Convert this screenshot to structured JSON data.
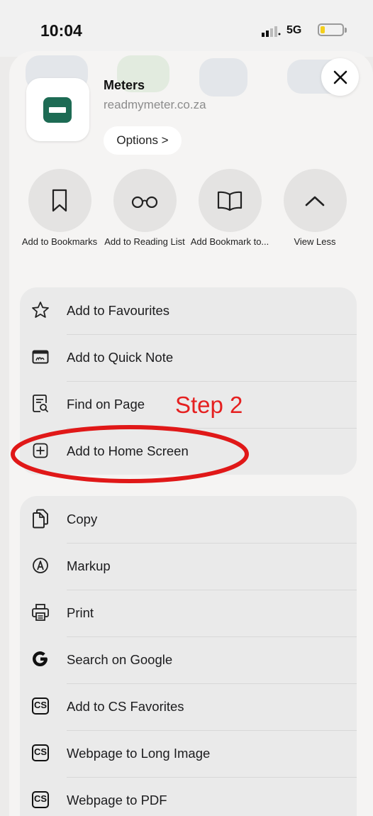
{
  "status_bar": {
    "time": "10:04",
    "network": "5G",
    "battery_level": 0.2
  },
  "header": {
    "app_title": "Meters",
    "app_url": "readmymeter.co.za",
    "options_label": "Options >",
    "close_icon": "close-icon",
    "app_icon": "meter-app-icon"
  },
  "actions": [
    {
      "label": "Add to Bookmarks",
      "icon": "bookmark-icon"
    },
    {
      "label": "Add to Reading List",
      "icon": "glasses-icon"
    },
    {
      "label": "Add Bookmark to...",
      "icon": "book-icon"
    },
    {
      "label": "View Less",
      "icon": "chevron-up-icon"
    }
  ],
  "menu_group_1": [
    {
      "label": "Add to Favourites",
      "icon": "star-icon"
    },
    {
      "label": "Add to Quick Note",
      "icon": "quick-note-icon"
    },
    {
      "label": "Find on Page",
      "icon": "find-on-page-icon"
    },
    {
      "label": "Add to Home Screen",
      "icon": "plus-square-icon"
    }
  ],
  "menu_group_2": [
    {
      "label": "Copy",
      "icon": "copy-icon"
    },
    {
      "label": "Markup",
      "icon": "markup-icon"
    },
    {
      "label": "Print",
      "icon": "print-icon"
    },
    {
      "label": "Search on Google",
      "icon": "google-icon"
    },
    {
      "label": "Add to CS Favorites",
      "icon": "cs-icon",
      "icon_text": "CS"
    },
    {
      "label": "Webpage to Long Image",
      "icon": "cs-icon",
      "icon_text": "CS"
    },
    {
      "label": "Webpage to PDF",
      "icon": "cs-icon",
      "icon_text": "CS"
    }
  ],
  "annotation": {
    "text": "Step 2",
    "color": "#e52020"
  },
  "colors": {
    "app_icon_green": "#1d6b54",
    "battery_yellow": "#f4cf1c"
  }
}
